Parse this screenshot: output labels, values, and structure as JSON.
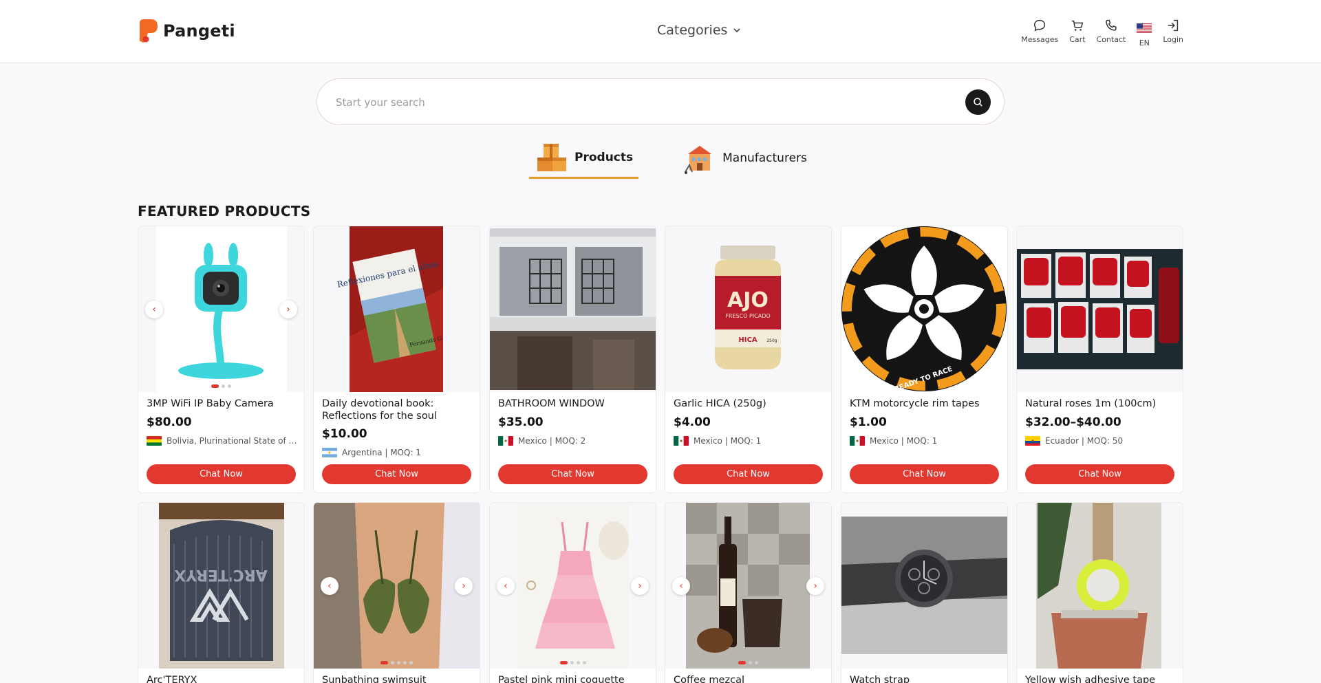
{
  "header": {
    "logo_text": "Pangeti",
    "categories_label": "Categories",
    "nav": [
      {
        "label": "Messages",
        "icon": "chat-bubble-icon"
      },
      {
        "label": "Cart",
        "icon": "cart-icon"
      },
      {
        "label": "Contact",
        "icon": "phone-icon"
      },
      {
        "label": "EN",
        "icon": "us-flag-icon"
      },
      {
        "label": "Login",
        "icon": "login-icon"
      }
    ]
  },
  "search": {
    "placeholder": "Start your search"
  },
  "tabs": [
    {
      "label": "Products",
      "active": true
    },
    {
      "label": "Manufacturers",
      "active": false
    }
  ],
  "featured": {
    "title": "FEATURED PRODUCTS",
    "chat_label": "Chat Now",
    "products": [
      {
        "title": "3MP WiFi IP Baby Camera",
        "price": "$80.00",
        "meta": "Bolivia, Plurinational State of | …"
      },
      {
        "title": "Daily devotional book: Reflections for the soul",
        "price": "$10.00",
        "meta": "Argentina | MOQ: 1"
      },
      {
        "title": "BATHROOM WINDOW",
        "price": "$35.00",
        "meta": "Mexico | MOQ: 2"
      },
      {
        "title": "Garlic HICA (250g)",
        "price": "$4.00",
        "meta": "Mexico | MOQ: 1"
      },
      {
        "title": "KTM motorcycle rim tapes",
        "price": "$1.00",
        "meta": "Mexico | MOQ: 1"
      },
      {
        "title": "Natural roses 1m (100cm)",
        "price": "$32.00–$40.00",
        "meta": "Ecuador | MOQ: 50"
      },
      {
        "title": "Arc'TERYX"
      },
      {
        "title": "Sunbathing swimsuit"
      },
      {
        "title": "Pastel pink mini coquette"
      },
      {
        "title": "Coffee mezcal"
      },
      {
        "title": "Watch strap"
      },
      {
        "title": "Yellow wish adhesive tape"
      }
    ]
  },
  "image_text": {
    "book_title": "Reflexiones para el alma",
    "book_author": "Fernando G",
    "jar_brand": "AJO",
    "jar_sub": "FRESCO PICADO",
    "jar_label": "HICA",
    "jar_weight": "250g",
    "rim_text": "READY TO RACE",
    "beanie_brand": "ARC'TERYX"
  },
  "colors": {
    "brand_red": "#e2382f",
    "brand_orange": "#f26a21",
    "tab_underline": "#e69d2f"
  }
}
